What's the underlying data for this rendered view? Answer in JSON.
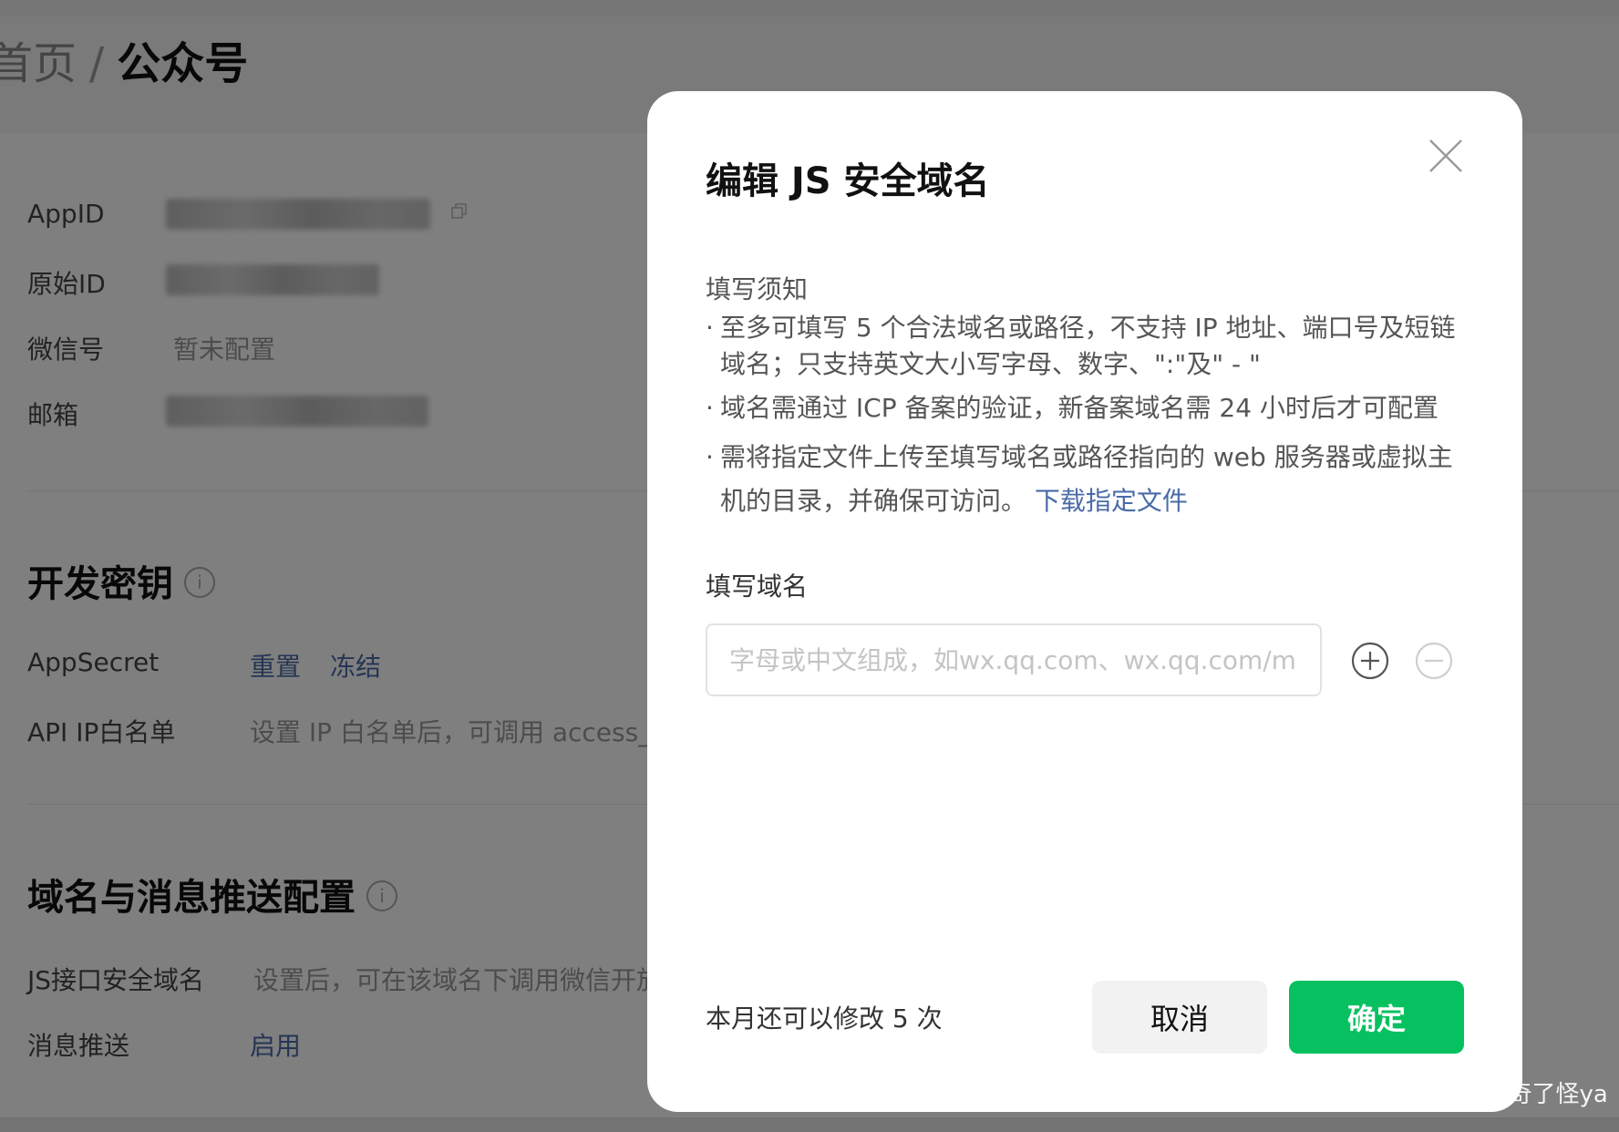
{
  "breadcrumb": {
    "home": "首页",
    "separator": "/",
    "current": "公众号"
  },
  "account_info": {
    "appid_label": "AppID",
    "original_id_label": "原始ID",
    "wechat_id_label": "微信号",
    "wechat_id_value": "暂未配置",
    "email_label": "邮箱"
  },
  "dev_key_section": {
    "title": "开发密钥",
    "appsecret_label": "AppSecret",
    "reset_link": "重置",
    "freeze_link": "冻结",
    "api_ip_label": "API IP白名单",
    "api_ip_desc": "设置 IP 白名单后，可调用 access_t"
  },
  "domain_section": {
    "title": "域名与消息推送配置",
    "js_domain_label": "JS接口安全域名",
    "js_domain_desc": "设置后，可在该域名下调用微信开放",
    "push_label": "消息推送",
    "push_link": "启用"
  },
  "modal": {
    "title": "编辑 JS 安全域名",
    "notice_title": "填写须知",
    "notice_items": [
      "至多可填写 5 个合法域名或路径，不支持 IP 地址、端口号及短链域名；只支持英文大小写字母、数字、\":\"及\" - \"",
      "域名需通过 ICP 备案的验证，新备案域名需 24 小时后才可配置",
      "需将指定文件上传至填写域名或路径指向的 web 服务器或虚拟主机的目录，并确保可访问。"
    ],
    "download_link": "下载指定文件",
    "field_label": "填写域名",
    "input_placeholder": "字母或中文组成，如wx.qq.com、wx.qq.com/mp",
    "input_value": "",
    "remaining_text": "本月还可以修改 5 次",
    "cancel_label": "取消",
    "confirm_label": "确定"
  },
  "watermark": "掘金技术社区 @ 奇了怪ya",
  "colors": {
    "primary_green": "#07c160",
    "link_blue": "#4a6ba8",
    "overlay": "rgba(0,0,0,0.5)"
  }
}
